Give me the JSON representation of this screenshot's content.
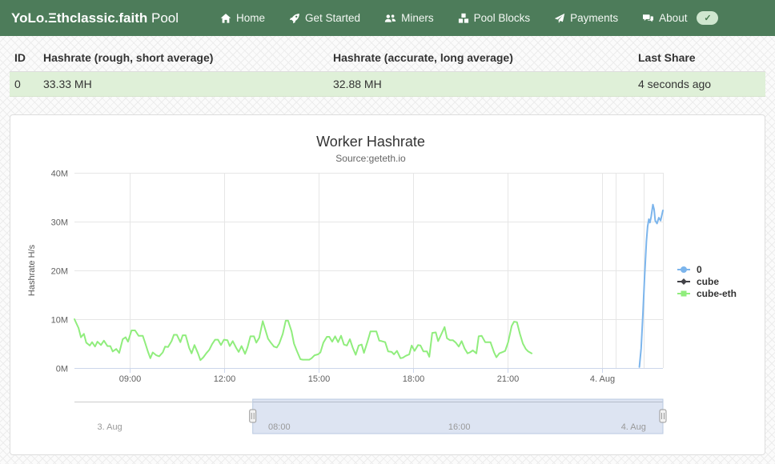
{
  "navbar": {
    "brand_bold": "YoLo.Ξthclassic.faith",
    "brand_regular": " Pool",
    "items": [
      {
        "label": "Home",
        "icon": "home-icon"
      },
      {
        "label": "Get Started",
        "icon": "rocket-icon"
      },
      {
        "label": "Miners",
        "icon": "users-icon"
      },
      {
        "label": "Pool Blocks",
        "icon": "cubes-icon"
      },
      {
        "label": "Payments",
        "icon": "paper-plane-icon"
      },
      {
        "label": "About",
        "icon": "comments-icon"
      }
    ],
    "badge_check": "✓"
  },
  "worker_table": {
    "headers": [
      "ID",
      "Hashrate (rough, short average)",
      "Hashrate (accurate, long average)",
      "Last Share"
    ],
    "rows": [
      {
        "id": "0",
        "hashrate_short": "33.33 MH",
        "hashrate_long": "32.88 MH",
        "last_share": "4 seconds ago"
      }
    ]
  },
  "colors": {
    "navbar_bg": "#4d7c5a",
    "badge_bg": "#cfe7cf",
    "row_success_bg": "#dff0d8",
    "series_blue": "#7cb5ec",
    "series_dark": "#434348",
    "series_green": "#90ed7d"
  },
  "chart_data": {
    "type": "line",
    "title": "Worker Hashrate",
    "subtitle": "Source:geteth.io",
    "ylabel": "Hashrate H/s",
    "y_unit": "M",
    "ylim": [
      0,
      40
    ],
    "grid": true,
    "legend_position": "right",
    "style": {
      "grid": "#e6e6e6",
      "axis": "#ccd6eb",
      "nav_mask": "rgba(102,133,194,0.22)",
      "nav_outline": "#cccccc"
    },
    "yticks": [
      {
        "value": 0,
        "label": "0M"
      },
      {
        "value": 10,
        "label": "10M"
      },
      {
        "value": 20,
        "label": "20M"
      },
      {
        "value": 30,
        "label": "30M"
      },
      {
        "value": 40,
        "label": "40M"
      }
    ],
    "xticks": [
      {
        "frac": 0.094,
        "label": "09:00"
      },
      {
        "frac": 0.254,
        "label": "12:00"
      },
      {
        "frac": 0.415,
        "label": "15:00"
      },
      {
        "frac": 0.575,
        "label": "18:00"
      },
      {
        "frac": 0.736,
        "label": "21:00"
      },
      {
        "frac": 0.897,
        "label": "4. Aug"
      }
    ],
    "extra_gridlines": [
      0.92,
      0.967,
      1.0
    ],
    "series": [
      {
        "name": "0",
        "color": "#7cb5ec",
        "marker": "circle",
        "points": [
          [
            0.96,
            0.2
          ],
          [
            0.963,
            4.0
          ],
          [
            0.966,
            11.0
          ],
          [
            0.969,
            19.0
          ],
          [
            0.972,
            26.0
          ],
          [
            0.974,
            29.0
          ],
          [
            0.976,
            30.5
          ],
          [
            0.978,
            29.8
          ],
          [
            0.98,
            31.0
          ],
          [
            0.983,
            33.5
          ],
          [
            0.985,
            32.5
          ],
          [
            0.987,
            30.2
          ],
          [
            0.99,
            29.6
          ],
          [
            0.993,
            30.8
          ],
          [
            0.996,
            30.2
          ],
          [
            1.0,
            32.3
          ]
        ]
      },
      {
        "name": "cube",
        "color": "#434348",
        "marker": "diamond",
        "points": []
      },
      {
        "name": "cube-eth",
        "color": "#90ed7d",
        "marker": "square",
        "points": [
          [
            0.0,
            10.0
          ],
          [
            0.007,
            8.2
          ],
          [
            0.011,
            6.3
          ],
          [
            0.016,
            7.0
          ],
          [
            0.02,
            5.2
          ],
          [
            0.026,
            4.6
          ],
          [
            0.03,
            5.3
          ],
          [
            0.035,
            4.4
          ],
          [
            0.039,
            5.4
          ],
          [
            0.045,
            4.7
          ],
          [
            0.05,
            5.6
          ],
          [
            0.056,
            4.5
          ],
          [
            0.061,
            4.5
          ],
          [
            0.065,
            3.4
          ],
          [
            0.071,
            3.9
          ],
          [
            0.076,
            3.1
          ],
          [
            0.082,
            5.9
          ],
          [
            0.087,
            6.3
          ],
          [
            0.091,
            5.4
          ],
          [
            0.097,
            7.7
          ],
          [
            0.103,
            7.7
          ],
          [
            0.109,
            6.6
          ],
          [
            0.116,
            6.6
          ],
          [
            0.12,
            5.2
          ],
          [
            0.125,
            3.3
          ],
          [
            0.129,
            2.0
          ],
          [
            0.133,
            3.2
          ],
          [
            0.139,
            2.6
          ],
          [
            0.144,
            2.4
          ],
          [
            0.15,
            3.2
          ],
          [
            0.154,
            4.4
          ],
          [
            0.159,
            4.3
          ],
          [
            0.165,
            5.5
          ],
          [
            0.169,
            6.8
          ],
          [
            0.174,
            6.8
          ],
          [
            0.18,
            5.3
          ],
          [
            0.184,
            6.7
          ],
          [
            0.189,
            6.7
          ],
          [
            0.195,
            4.1
          ],
          [
            0.199,
            3.0
          ],
          [
            0.204,
            4.7
          ],
          [
            0.21,
            3.0
          ],
          [
            0.214,
            1.6
          ],
          [
            0.219,
            2.2
          ],
          [
            0.224,
            3.0
          ],
          [
            0.229,
            3.7
          ],
          [
            0.234,
            4.9
          ],
          [
            0.239,
            5.8
          ],
          [
            0.244,
            5.8
          ],
          [
            0.249,
            4.7
          ],
          [
            0.254,
            5.8
          ],
          [
            0.26,
            5.7
          ],
          [
            0.264,
            4.5
          ],
          [
            0.269,
            5.5
          ],
          [
            0.275,
            4.1
          ],
          [
            0.279,
            3.3
          ],
          [
            0.284,
            4.5
          ],
          [
            0.29,
            2.9
          ],
          [
            0.294,
            4.2
          ],
          [
            0.299,
            6.5
          ],
          [
            0.305,
            6.5
          ],
          [
            0.309,
            5.2
          ],
          [
            0.314,
            6.2
          ],
          [
            0.32,
            9.6
          ],
          [
            0.324,
            8.0
          ],
          [
            0.329,
            6.0
          ],
          [
            0.333,
            5.3
          ],
          [
            0.339,
            4.4
          ],
          [
            0.344,
            4.2
          ],
          [
            0.348,
            5.0
          ],
          [
            0.354,
            7.0
          ],
          [
            0.359,
            9.7
          ],
          [
            0.363,
            9.7
          ],
          [
            0.369,
            7.5
          ],
          [
            0.373,
            5.0
          ],
          [
            0.378,
            3.5
          ],
          [
            0.384,
            1.8
          ],
          [
            0.388,
            1.7
          ],
          [
            0.393,
            1.7
          ],
          [
            0.399,
            1.7
          ],
          [
            0.403,
            2.0
          ],
          [
            0.408,
            2.6
          ],
          [
            0.414,
            2.8
          ],
          [
            0.418,
            3.2
          ],
          [
            0.423,
            5.2
          ],
          [
            0.429,
            6.4
          ],
          [
            0.433,
            6.4
          ],
          [
            0.438,
            5.4
          ],
          [
            0.443,
            6.5
          ],
          [
            0.448,
            5.3
          ],
          [
            0.453,
            6.6
          ],
          [
            0.458,
            4.8
          ],
          [
            0.463,
            4.6
          ],
          [
            0.468,
            5.9
          ],
          [
            0.473,
            4.1
          ],
          [
            0.478,
            2.7
          ],
          [
            0.483,
            4.6
          ],
          [
            0.488,
            4.8
          ],
          [
            0.492,
            3.1
          ],
          [
            0.498,
            5.4
          ],
          [
            0.503,
            7.5
          ],
          [
            0.507,
            7.5
          ],
          [
            0.513,
            7.5
          ],
          [
            0.518,
            5.6
          ],
          [
            0.522,
            5.5
          ],
          [
            0.528,
            5.3
          ],
          [
            0.533,
            3.4
          ],
          [
            0.539,
            3.3
          ],
          [
            0.543,
            2.8
          ],
          [
            0.548,
            3.5
          ],
          [
            0.554,
            2.0
          ],
          [
            0.558,
            2.1
          ],
          [
            0.563,
            2.5
          ],
          [
            0.569,
            2.8
          ],
          [
            0.573,
            4.6
          ],
          [
            0.578,
            3.5
          ],
          [
            0.584,
            4.7
          ],
          [
            0.588,
            4.6
          ],
          [
            0.593,
            3.4
          ],
          [
            0.599,
            3.4
          ],
          [
            0.603,
            2.3
          ],
          [
            0.608,
            7.2
          ],
          [
            0.614,
            7.3
          ],
          [
            0.618,
            5.5
          ],
          [
            0.623,
            6.8
          ],
          [
            0.629,
            8.4
          ],
          [
            0.633,
            6.1
          ],
          [
            0.638,
            5.7
          ],
          [
            0.643,
            5.7
          ],
          [
            0.648,
            5.2
          ],
          [
            0.653,
            4.4
          ],
          [
            0.658,
            5.5
          ],
          [
            0.663,
            4.0
          ],
          [
            0.668,
            3.0
          ],
          [
            0.672,
            3.2
          ],
          [
            0.677,
            3.6
          ],
          [
            0.683,
            3.0
          ],
          [
            0.687,
            6.5
          ],
          [
            0.692,
            6.6
          ],
          [
            0.698,
            5.3
          ],
          [
            0.702,
            5.3
          ],
          [
            0.707,
            5.3
          ],
          [
            0.713,
            3.2
          ],
          [
            0.717,
            2.2
          ],
          [
            0.722,
            3.0
          ],
          [
            0.728,
            3.3
          ],
          [
            0.732,
            3.5
          ],
          [
            0.737,
            5.3
          ],
          [
            0.743,
            8.6
          ],
          [
            0.747,
            9.5
          ],
          [
            0.752,
            9.4
          ],
          [
            0.757,
            7.0
          ],
          [
            0.762,
            5.0
          ],
          [
            0.767,
            3.9
          ],
          [
            0.771,
            3.4
          ],
          [
            0.777,
            3.0
          ]
        ]
      }
    ],
    "navigator": {
      "selection": [
        0.303,
        1.0
      ],
      "labels": [
        {
          "frac": 0.06,
          "label": "3. Aug"
        },
        {
          "frac": 0.348,
          "label": "08:00"
        },
        {
          "frac": 0.654,
          "label": "16:00"
        },
        {
          "frac": 0.95,
          "label": "4. Aug"
        }
      ]
    }
  }
}
